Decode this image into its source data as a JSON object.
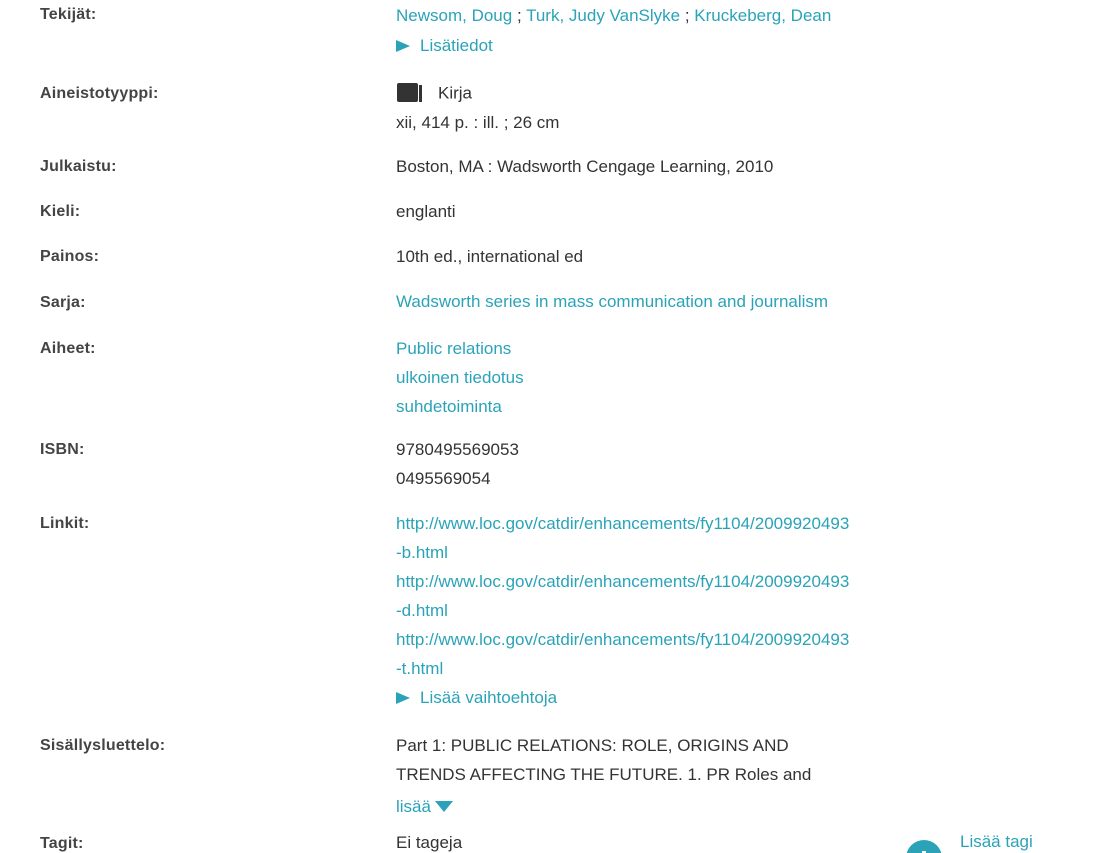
{
  "fields": {
    "authors": {
      "label": "Tekijät:",
      "names": [
        "Newsom, Doug",
        "Turk, Judy VanSlyke",
        "Kruckeberg, Dean"
      ],
      "separator": " ; ",
      "more_info": "Lisätiedot"
    },
    "material_type": {
      "label": "Aineistotyyppi:",
      "icon": "book-icon",
      "type": "Kirja",
      "extent": "xii, 414 p. : ill. ; 26 cm"
    },
    "published": {
      "label": "Julkaistu:",
      "value": "Boston, MA : Wadsworth Cengage Learning, 2010"
    },
    "language": {
      "label": "Kieli:",
      "value": "englanti"
    },
    "edition": {
      "label": "Painos:",
      "value": "10th ed., international ed"
    },
    "series": {
      "label": "Sarja:",
      "value": "Wadsworth series in mass communication and journalism"
    },
    "subjects": {
      "label": "Aiheet:",
      "items": [
        "Public relations",
        "ulkoinen tiedotus",
        "suhdetoiminta"
      ]
    },
    "isbn": {
      "label": "ISBN:",
      "items": [
        "9780495569053",
        "0495569054"
      ]
    },
    "links": {
      "label": "Linkit:",
      "items": [
        {
          "line1": "http://www.loc.gov/catdir/enhancements/fy1104/2009920493",
          "line2": "-b.html"
        },
        {
          "line1": "http://www.loc.gov/catdir/enhancements/fy1104/2009920493",
          "line2": "-d.html"
        },
        {
          "line1": "http://www.loc.gov/catdir/enhancements/fy1104/2009920493",
          "line2": "-t.html"
        }
      ],
      "more_options": "Lisää vaihtoehtoja"
    },
    "contents": {
      "label": "Sisällysluettelo:",
      "line1": "Part 1: PUBLIC RELATIONS: ROLE, ORIGINS AND",
      "line2": "TRENDS AFFECTING THE FUTURE. 1. PR Roles and",
      "more": "lisää"
    },
    "tags": {
      "label": "Tagit:",
      "value": "Ei tageja",
      "add_tag": "Lisää tagi"
    }
  },
  "colors": {
    "link": "#2aa3b8",
    "text": "#333333",
    "label": "#444444"
  }
}
